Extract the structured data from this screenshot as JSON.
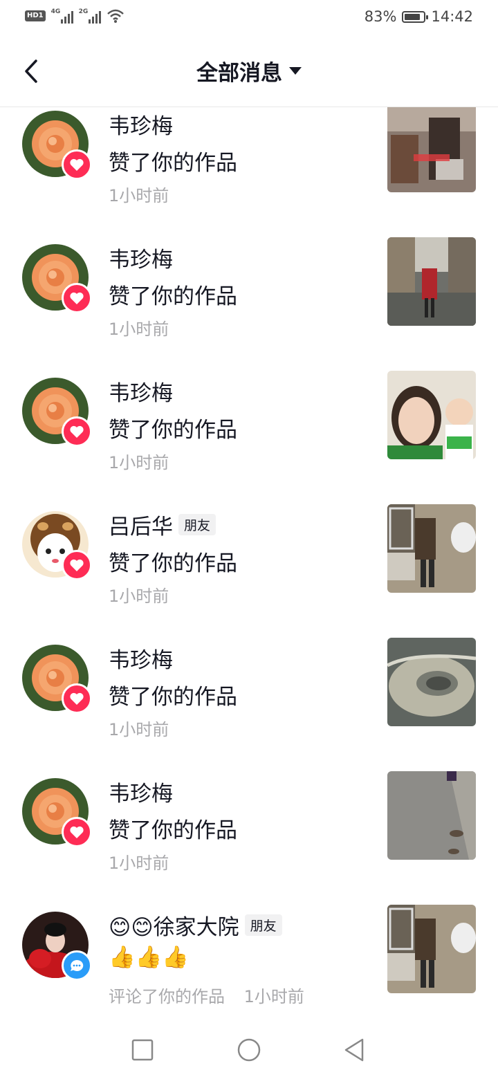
{
  "status_bar": {
    "network_1": "4G",
    "network_2": "2G",
    "battery_text": "83%",
    "battery_level": 0.83,
    "time": "14:42"
  },
  "header": {
    "title": "全部消息"
  },
  "notifications": [
    {
      "name": "韦珍梅",
      "action": "赞了你的作品",
      "time": "1小时前",
      "type": "like",
      "icon": "heart-icon"
    },
    {
      "name": "韦珍梅",
      "action": "赞了你的作品",
      "time": "1小时前",
      "type": "like",
      "icon": "heart-icon"
    },
    {
      "name": "韦珍梅",
      "action": "赞了你的作品",
      "time": "1小时前",
      "type": "like",
      "icon": "heart-icon"
    },
    {
      "name": "吕后华",
      "tag": "朋友",
      "action": "赞了你的作品",
      "time": "1小时前",
      "type": "like",
      "icon": "heart-icon"
    },
    {
      "name": "韦珍梅",
      "action": "赞了你的作品",
      "time": "1小时前",
      "type": "like",
      "icon": "heart-icon"
    },
    {
      "name": "韦珍梅",
      "action": "赞了你的作品",
      "time": "1小时前",
      "type": "like",
      "icon": "heart-icon"
    },
    {
      "name": "😊😊徐家大院",
      "tag": "朋友",
      "comment": "👍👍👍",
      "action": "评论了你的作品",
      "time": "1小时前",
      "type": "comment",
      "icon": "comment-icon"
    }
  ],
  "colors": {
    "like_badge": "#fe2c55",
    "comment_badge": "#2a9cf8",
    "secondary_text": "#a8a8ab"
  }
}
